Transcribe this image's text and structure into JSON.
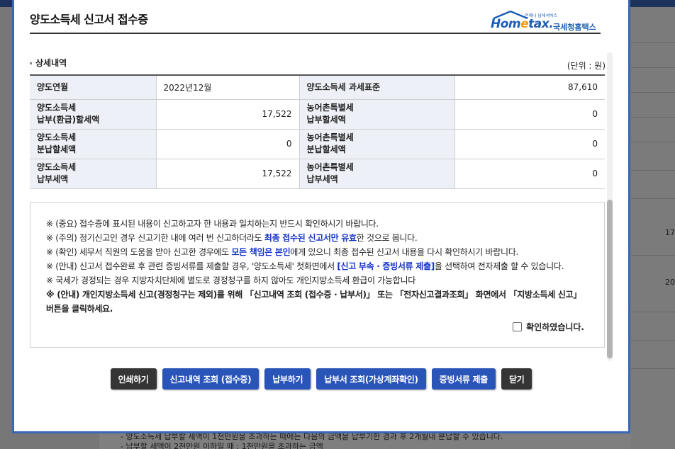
{
  "background": {
    "cells": [
      "17,",
      "20"
    ],
    "bottom_lines": [
      "- 양도소득세 납부할 세액이 1천만원을 초과하는 때에는 다음의 금액을 납부기한 경과 후 2개월내 분납할 수 있습니다.",
      "- 납부할 세액이 2천만원 이하일 때 : 1천만원을 초과하는 금액"
    ]
  },
  "modal": {
    "title": "양도소득세 신고서 접수증",
    "logo": {
      "tagline": "언제나 납세서비스",
      "brand_pre": "Hom",
      "brand_mid": "e",
      "brand_post": "tax.",
      "korean": "국세청홈택스"
    },
    "section_title": "상세내역",
    "unit_label": "(단위 : 원)",
    "detail_rows": [
      {
        "label1": "양도연월",
        "value1": "2022년12월",
        "label2": "양도소득세 과세표준",
        "value2": "87,610"
      },
      {
        "label1": "양도소득세\n납부(환급)할세액",
        "value1": "17,522",
        "label2": "농어촌특별세\n납부할세액",
        "value2": "0"
      },
      {
        "label1": "양도소득세\n분납할세액",
        "value1": "0",
        "label2": "농어촌특별세\n분납할세액",
        "value2": "0"
      },
      {
        "label1": "양도소득세\n납부세액",
        "value1": "17,522",
        "label2": "농어촌특별세\n납부세액",
        "value2": "0"
      }
    ],
    "notices": {
      "n1": "※ (중요) 접수증에 표시된 내용이 신고하고자 한 내용과 일치하는지 반드시 확인하시기 바랍니다.",
      "n2_a": "※ (주의) 정기신고인 경우 신고기한 내에 여러 번 신고하더라도 ",
      "n2_b": "최종 접수된 신고서만 유효",
      "n2_c": "한 것으로 봅니다.",
      "n3_a": "※ (확인) 세무서 직원의 도움을 받아 신고한 경우에도 ",
      "n3_b": "모든 책임은 본인",
      "n3_c": "에게 있으니 최종 접수된 신고서 내용을 다시 확인하시기 바랍니다.",
      "n4_a": "※ (안내) 신고서 접수완료 후 관련 증빙서류를 제출할 경우, '양도소득세' 첫화면에서 ",
      "n4_b": "[신고 부속 · 증빙서류 제출]",
      "n4_c": "을 선택하여 전자제출 할 수 있습니다.",
      "n5": "※ 국세가 경정되는 경우 지방자치단체에 별도로 경정청구를 하지 않아도 개인지방소득세 환급이 가능합니다",
      "n6": "※ (안내) 개인지방소득세 신고(경정청구는 제외)를 위해 「신고내역 조회 (접수증 · 납부서)」 또는 「전자신고결과조회」 화면에서 「지방소득세 신고」 버튼을 클릭하세요."
    },
    "confirm_label": "확인하였습니다.",
    "buttons": {
      "print": "인쇄하기",
      "history": "신고내역 조회 (접수증)",
      "pay": "납부하기",
      "bill": "납부서 조회(가상계좌확인)",
      "evidence": "증빙서류 제출",
      "close": "닫기"
    },
    "colors": {
      "frame": "#3b67b7",
      "dark_button": "#353535",
      "blue_button": "#2a55b8",
      "emphasis_blue": "#1432c8",
      "emphasis_red": "#e00000",
      "header_cell": "#eef0f7"
    }
  }
}
